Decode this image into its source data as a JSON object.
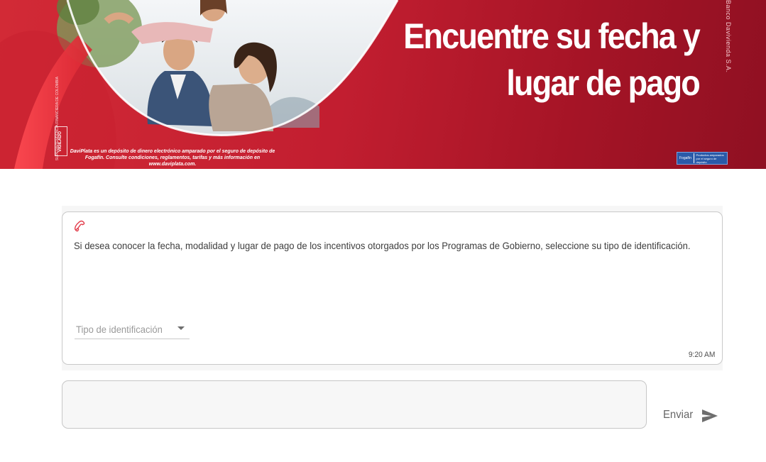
{
  "banner": {
    "title_line1": "Encuentre su fecha y",
    "title_line2": "lugar de pago",
    "brand_vertical": "Banco Davivienda S.A.",
    "vigilado": "VIGILADO",
    "superintendencia": "SUPERINTENDENCIA FINANCIERA DE COLOMBIA",
    "disclaimer": "DaviPlata es un depósito de dinero electrónico amparado por el seguro de depósito de Fogafín. Consulte condiciones, reglamentos, tarifas y más información en www.daviplata.com.",
    "fogafin_logo": "Fogafín",
    "fogafin_text": "Productos amparados por el seguro de depósito",
    "colors": {
      "brand_red": "#c21e30",
      "dark_red": "#8f1022"
    }
  },
  "chat": {
    "bot_icon": "phone-icon",
    "message": "Si desea conocer la fecha, modalidad y lugar de pago de los incentivos otorgados por los Programas de Gobierno, seleccione su tipo de identificación.",
    "select_placeholder": "Tipo de identificación",
    "time": "9:20 AM"
  },
  "composer": {
    "value": "",
    "send_label": "Enviar",
    "send_icon": "send-arrow-icon"
  }
}
